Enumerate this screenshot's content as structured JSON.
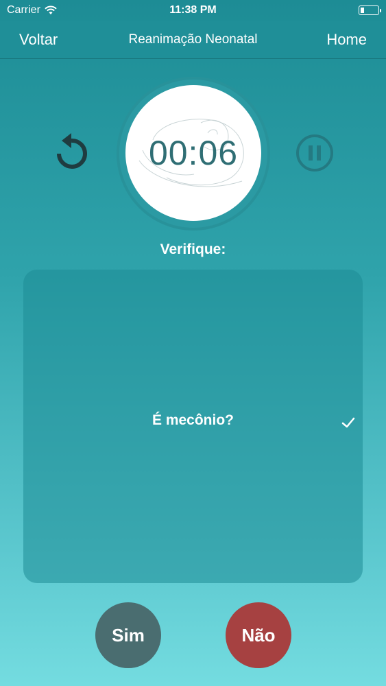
{
  "status_bar": {
    "carrier": "Carrier",
    "time": "11:38 PM"
  },
  "nav": {
    "back_label": "Voltar",
    "title": "Reanimação Neonatal",
    "home_label": "Home"
  },
  "timer": {
    "display": "00:06"
  },
  "prompt": {
    "label": "Verifique:"
  },
  "question": {
    "text": "É mecônio?"
  },
  "answers": {
    "yes_label": "Sim",
    "no_label": "Não"
  },
  "colors": {
    "yes": "#4a6d70",
    "no": "#a64141",
    "timer_text": "#2f6e74"
  },
  "icons": {
    "reset": "reset-icon",
    "pause": "pause-icon",
    "check": "check-icon",
    "wifi": "wifi-icon",
    "battery": "battery-icon"
  }
}
